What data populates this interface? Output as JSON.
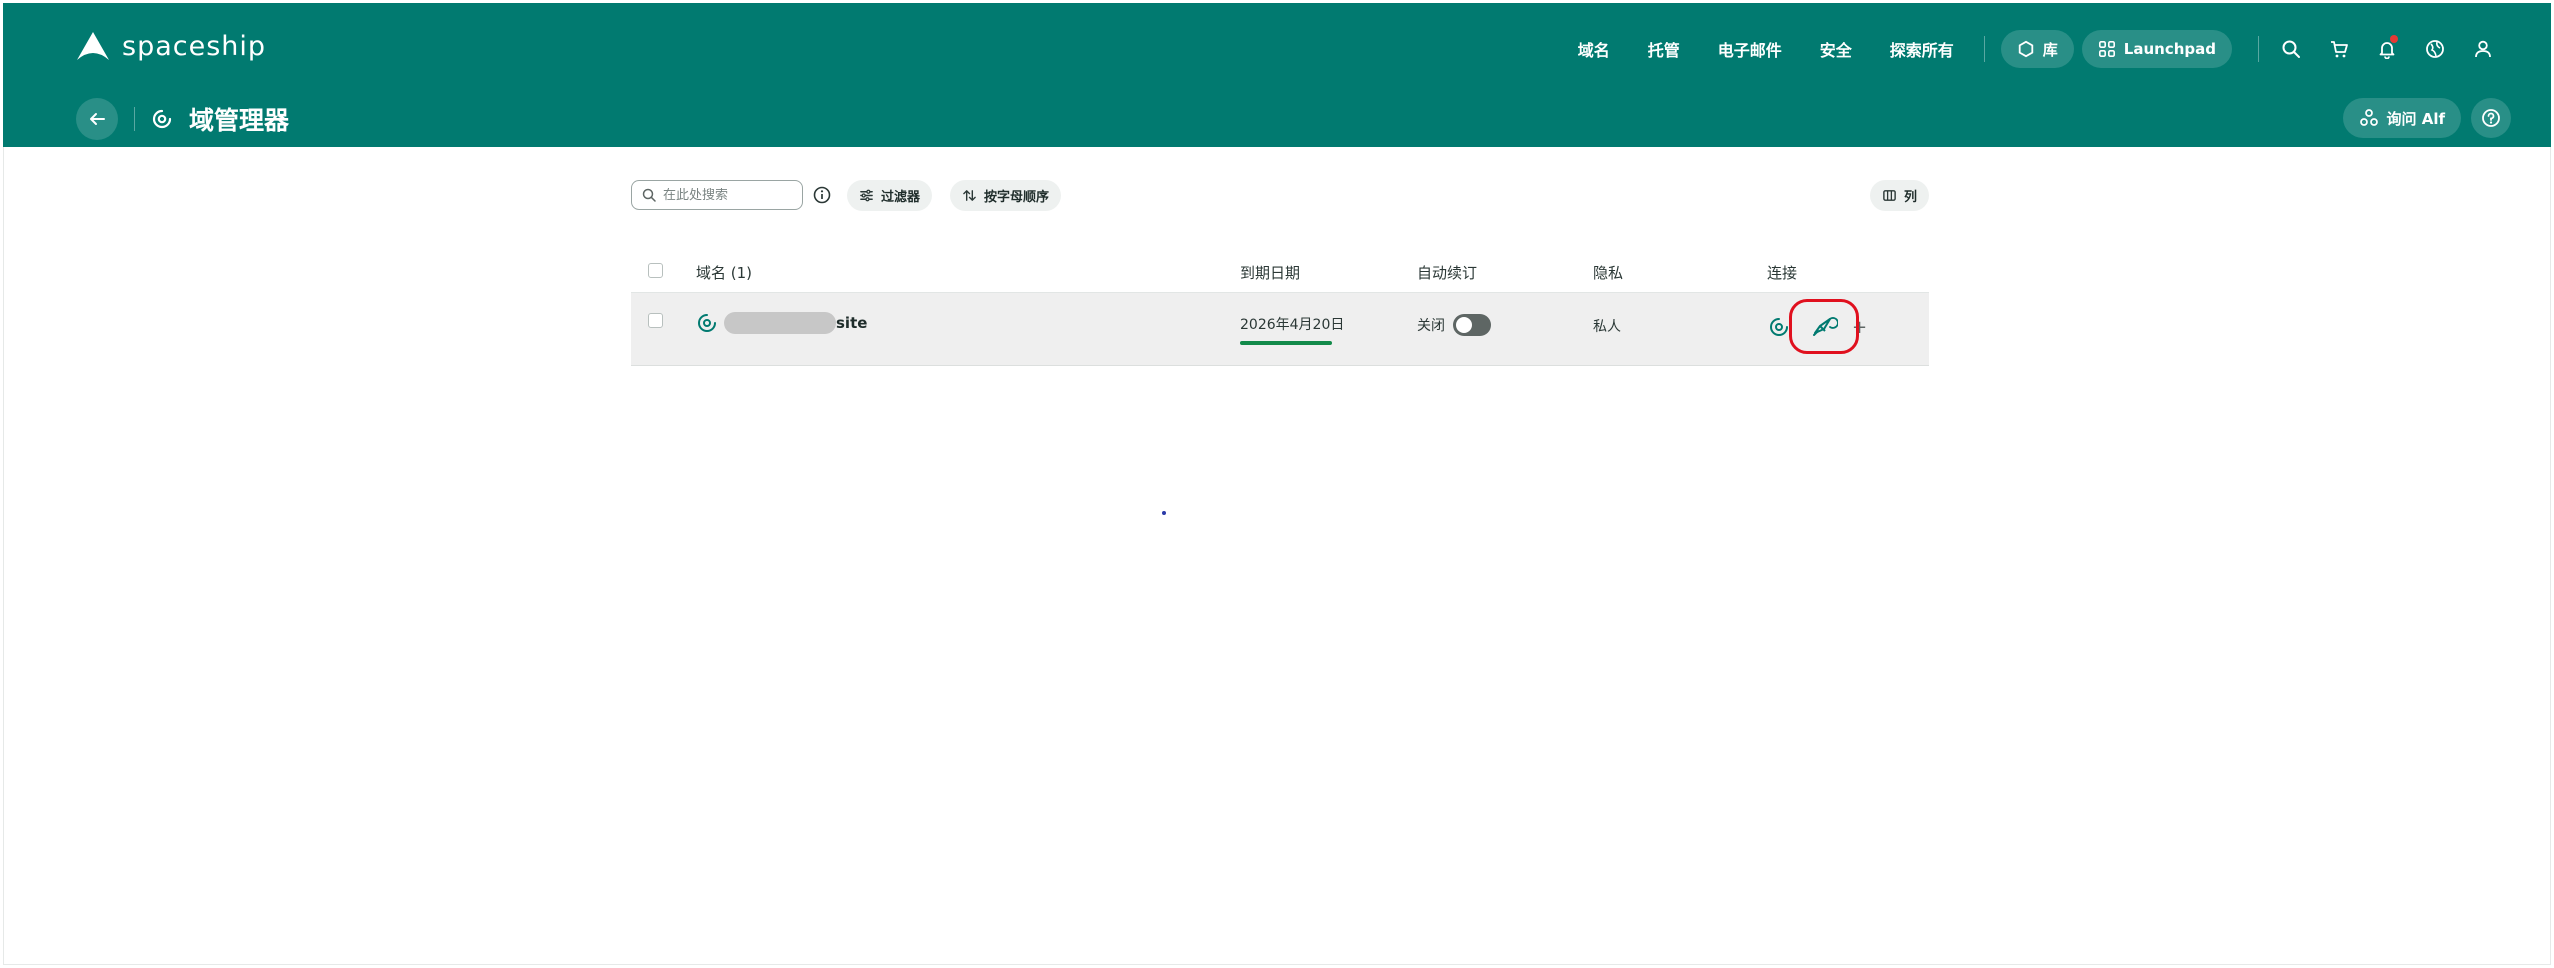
{
  "app": {
    "brand": "spaceship",
    "nav": [
      "域名",
      "托管",
      "电子邮件",
      "安全",
      "探索所有"
    ],
    "library_label": "库",
    "launchpad_label": "Launchpad",
    "icons": [
      "search-icon",
      "cart-icon",
      "bell-icon",
      "globe-icon",
      "user-icon"
    ],
    "accent_color": "#017a70"
  },
  "subheader": {
    "title": "域管理器",
    "ask_label": "询问 Alf"
  },
  "toolbar": {
    "search_placeholder": "在此处搜索",
    "filter_label": "过滤器",
    "sort_label": "按字母顺序",
    "columns_label": "列"
  },
  "table": {
    "headers": {
      "domain": "域名 (1)",
      "expiry": "到期日期",
      "auto_renew": "自动续订",
      "privacy": "隐私",
      "connect": "连接"
    },
    "rows": [
      {
        "domain_suffix": "site",
        "expiry": "2026年4月20日",
        "auto_renew_label": "关闭",
        "auto_renew_on": false,
        "privacy": "私人",
        "add_symbol": "+"
      }
    ]
  }
}
